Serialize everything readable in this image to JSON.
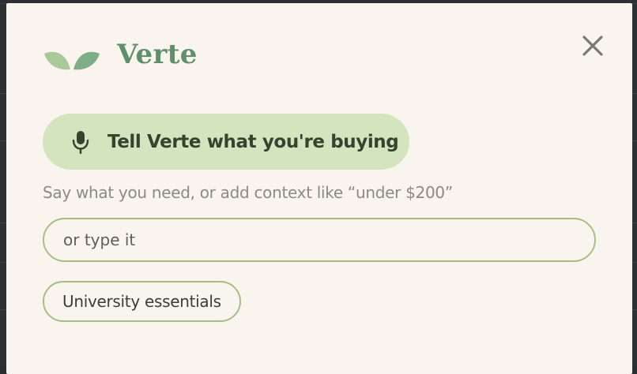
{
  "brand": {
    "name": "Verte",
    "logo_icon": "leaf-pair-icon",
    "color": "#5f8f6b"
  },
  "close": {
    "icon": "close-icon"
  },
  "voice": {
    "label": "Tell Verte what you're buying",
    "icon": "microphone-icon",
    "background": "#d4e4be"
  },
  "hint": {
    "text": "Say what you need, or add context like “under $200”"
  },
  "input": {
    "placeholder": "or type it",
    "value": ""
  },
  "suggestions": {
    "items": [
      {
        "label": "University essentials"
      }
    ]
  },
  "colors": {
    "panel": "#f9f5ee",
    "accent_border": "#a7bd86"
  }
}
